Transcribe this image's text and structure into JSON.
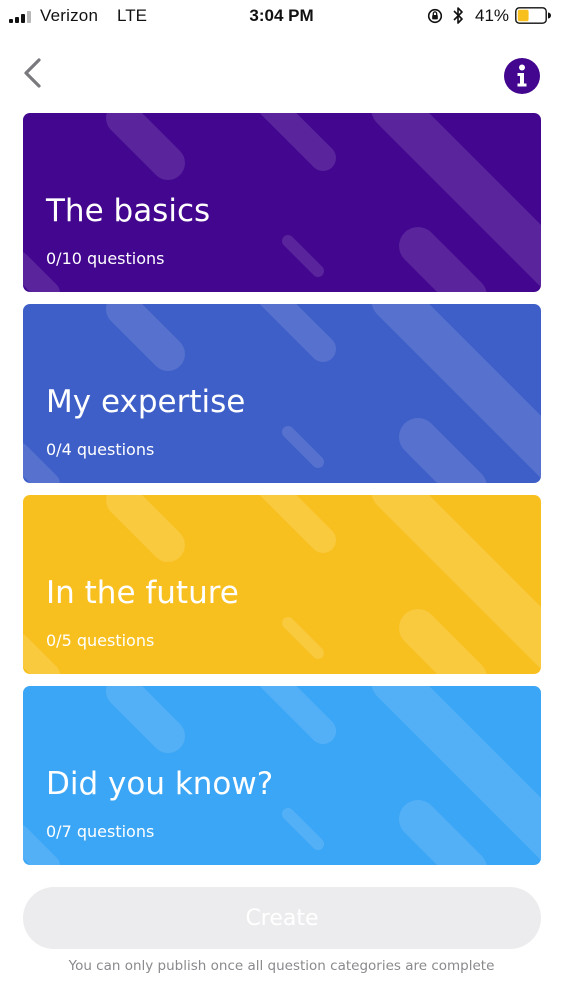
{
  "status_bar": {
    "carrier": "Verizon",
    "network": "LTE",
    "time": "3:04 PM",
    "battery_percent": "41%",
    "battery_level": 0.41,
    "battery_color": "#f8c01f",
    "icons": [
      "signal-icon",
      "orientation-lock-icon",
      "bluetooth-icon",
      "battery-icon"
    ]
  },
  "nav": {
    "back_icon": "chevron-left-icon",
    "info_icon": "info-icon",
    "info_color": "#43068f"
  },
  "categories": [
    {
      "title": "The basics",
      "subtitle": "0/10 questions",
      "color": "#43068f"
    },
    {
      "title": "My expertise",
      "subtitle": "0/4 questions",
      "color": "#3f5fc8"
    },
    {
      "title": "In the future",
      "subtitle": "0/5 questions",
      "color": "#f8c01f"
    },
    {
      "title": "Did you know?",
      "subtitle": "0/7 questions",
      "color": "#3ca6f6"
    }
  ],
  "create": {
    "label": "Create",
    "hint": "You can only publish once all question categories are complete"
  }
}
